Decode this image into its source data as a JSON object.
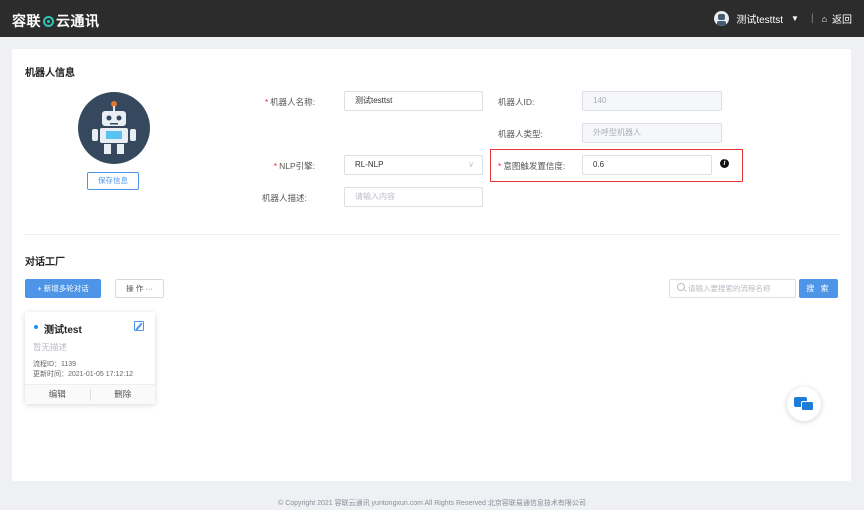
{
  "header": {
    "brand_part1": "容联",
    "brand_part2": "云通讯",
    "username": "测试testtst",
    "back_label": "返回"
  },
  "robot_info": {
    "title": "机器人信息",
    "save_label": "保存信息",
    "name_label": "机器人名称:",
    "name_value": "测试testtst",
    "id_label": "机器人ID:",
    "id_value": "140",
    "type_label": "机器人类型:",
    "type_value": "外呼型机器人",
    "nlp_label": "NLP引擎:",
    "nlp_value": "RL-NLP",
    "intent_label": "意图触发置信度:",
    "intent_value": "0.6",
    "desc_label": "机器人描述:",
    "desc_placeholder": "请输入内容"
  },
  "factory": {
    "title": "对话工厂",
    "add_label": "+ 新增多轮对话",
    "op_label": "操 作 ···",
    "search_placeholder": "请输入要搜索的流程名称",
    "search_label": "搜 索"
  },
  "flows": [
    {
      "name": "测试test",
      "desc": "暂无描述",
      "id_line": "流程ID：1139",
      "updated_line": "更新时间：2021-01-05 17:12:12",
      "edit_label": "编辑",
      "delete_label": "删除"
    }
  ],
  "footer": {
    "text": "© Copyright 2021   容联云通讯   yuntongxun.com   All Rights Reserved  北京容联易通信息技术有限公司"
  },
  "colors": {
    "primary": "#4e95e8",
    "topbar": "#2c2c2c",
    "highlight": "#e53935"
  }
}
